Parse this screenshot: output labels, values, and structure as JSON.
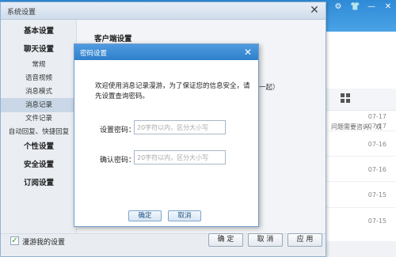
{
  "colors": {
    "accent": "#2f7fcc",
    "window_bg": "#f2f4f7",
    "nav_selected": "#c9d7e6",
    "check_green": "#2a9b2a"
  },
  "background_window": {
    "times": [
      "07-17",
      "07-17",
      "07-16",
      "07-16",
      "07-15"
    ],
    "snippet": "问题需要咨询，欢"
  },
  "settings_window": {
    "title": "系统设置",
    "nav": {
      "basic": "基本设置",
      "chat": "聊天设置",
      "chat_items": [
        "常规",
        "语音视频",
        "消息模式",
        "消息记录",
        "文件记录",
        "自动回复、快捷回复"
      ],
      "selected": "消息记录",
      "personal": "个性设置",
      "security": "安全设置",
      "subscription": "订阅设置"
    },
    "content_heading": "客户端设置",
    "content_fragment": "一起）",
    "footer": {
      "roam_checkbox_label": "漫游我的设置",
      "roam_checked": true,
      "ok": "确 定",
      "cancel": "取 消",
      "apply": "应 用"
    }
  },
  "password_dialog": {
    "title": "密码设置",
    "message": "欢迎使用消息记录漫游，为了保证您的信息安全，请先设置查询密码。",
    "password_label": "设置密码：",
    "password_placeholder": "20字符以内，区分大小写",
    "confirm_label": "确认密码：",
    "confirm_placeholder": "20字符以内，区分大小写",
    "ok": "确定",
    "cancel": "取消"
  }
}
